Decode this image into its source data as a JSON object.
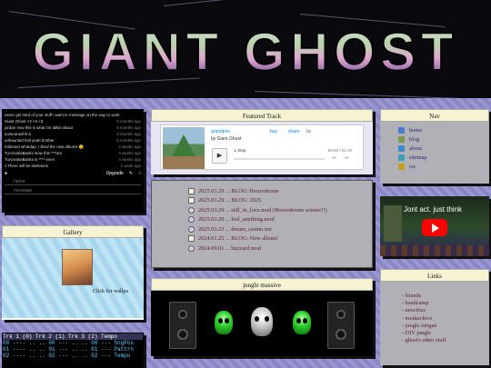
{
  "logo": {
    "text": "GIANT GHOST"
  },
  "chat": {
    "messages": [
      {
        "user": "never get tired of your stuff i want to message on the way to work",
        "time": ""
      },
      {
        "user": "Giant Ghost",
        "msg": "<3 <3 <3",
        "time": "6 months ago"
      },
      {
        "user": "jordan",
        "msg": "now this is what I'm talkin about",
        "time": "6 months ago"
      },
      {
        "user": "someoneshh",
        "msg": "a",
        "time": "6 months ago"
      },
      {
        "user": "unhaunted",
        "msg": "hell yeah brother",
        "time": "6 months ago"
      },
      {
        "user": "Iridiened",
        "msg": "whatdap. I liked the new albums 😊",
        "time": "4 weeks ago"
      },
      {
        "user": "TuAzeaIiaBanks",
        "msg": "wow this ***ism",
        "time": "4 weeks ago"
      },
      {
        "user": "TuAzeaIiaBanks",
        "msg": "is **** even",
        "time": "4 weeks ago"
      },
      {
        "user": "J",
        "msg": "There will be skeletons",
        "time": "1 week ago"
      }
    ],
    "upgrade_label": "Upgrade",
    "name_placeholder": "name",
    "message_placeholder": "message"
  },
  "gallery": {
    "title": "Gallery",
    "caption": "Click for wallpa"
  },
  "tracker": {
    "header": "Trk 1 (0) Trk 2 (1) Trk 3 (2) Tempo",
    "rows": [
      "00 ---- .. .. 00 --- .. .. 00 --- SngPos",
      "01 ---- .. .. 01 --- .. .. 01 --- Pattrn",
      "02 ---- .. .. 02 --- .. .. 02 --- Tempo"
    ]
  },
  "featured": {
    "title": "Featured Track",
    "track_name": "grandprix",
    "artist": "by Giant Ghost",
    "buy": "buy",
    "share": "share",
    "bc": "bc",
    "track_line": "1. blop",
    "time": "00:00 / 01:16"
  },
  "blog": {
    "items": [
      {
        "text": "2025.03.29 ... BLOG: Boozedrome",
        "icon": "page"
      },
      {
        "text": "2025.03.29 ... BLOG: 2025",
        "icon": "page"
      },
      {
        "text": "2025.03.29 ... still_in_love.mod (Boozedrome winner!!)",
        "icon": "cd"
      },
      {
        "text": "2025.03.29 ... feel_anything.mod",
        "icon": "cd"
      },
      {
        "text": "2025.03.23 ... dream_casino.xm",
        "icon": "cd"
      },
      {
        "text": "2024.01.25 ... BLOG: New album!",
        "icon": "page"
      },
      {
        "text": "2024.09.01 ... buzzard.mod",
        "icon": "cd"
      }
    ]
  },
  "jungle": {
    "title": "jungle massive"
  },
  "nav": {
    "title": "Nav",
    "items": [
      {
        "label": "home",
        "color": "#4a7bd0"
      },
      {
        "label": "blog",
        "color": "#7a9a4a"
      },
      {
        "label": "about",
        "color": "#3a8ad0"
      },
      {
        "label": "sitemap",
        "color": "#3aa0b0"
      },
      {
        "label": "rss",
        "color": "#c0a020"
      }
    ]
  },
  "video": {
    "title": "Jont act. just think"
  },
  "links": {
    "title": "Links",
    "items": [
      "- friends",
      "- bandcamp",
      "- neocities",
      "- modarchive",
      "- jungle fatigue",
      "- DIY jungle",
      "- ghost's other stuff"
    ]
  }
}
